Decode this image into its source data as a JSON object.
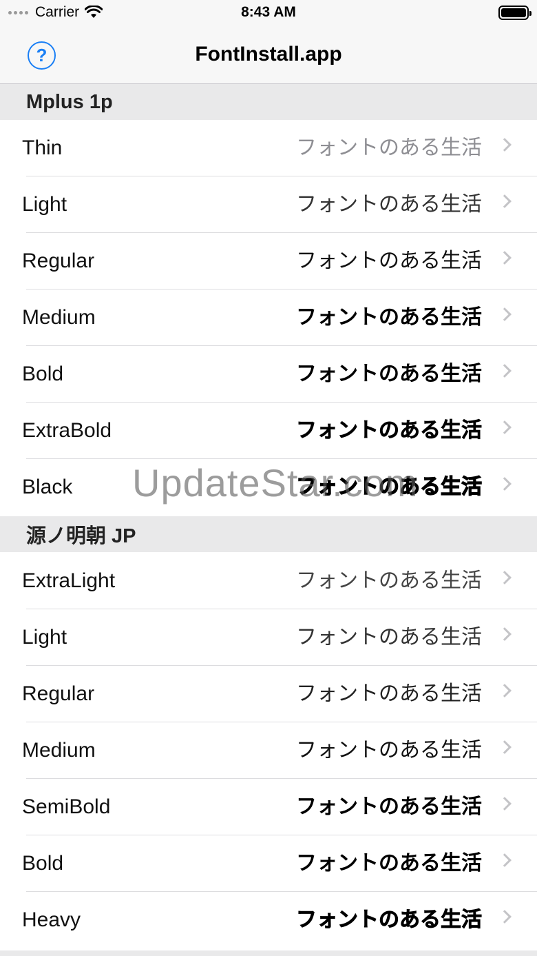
{
  "status": {
    "carrier": "Carrier",
    "time": "8:43 AM",
    "wifi_icon": "wifi-icon",
    "battery_icon": "battery-icon"
  },
  "nav": {
    "title": "FontInstall.app",
    "help_glyph": "?"
  },
  "watermark": "UpdateStar.com",
  "sample_text": "フォントのある生活",
  "sections": [
    {
      "title": "Mplus 1p",
      "rows": [
        {
          "label": "Thin",
          "sample": "フォントのある生活"
        },
        {
          "label": "Light",
          "sample": "フォントのある生活"
        },
        {
          "label": "Regular",
          "sample": "フォントのある生活"
        },
        {
          "label": "Medium",
          "sample": "フォントのある生活"
        },
        {
          "label": "Bold",
          "sample": "フォントのある生活"
        },
        {
          "label": "ExtraBold",
          "sample": "フォントのある生活"
        },
        {
          "label": "Black",
          "sample": "フォントのある生活"
        }
      ]
    },
    {
      "title": "源ノ明朝 JP",
      "rows": [
        {
          "label": "ExtraLight",
          "sample": "フォントのある生活"
        },
        {
          "label": "Light",
          "sample": "フォントのある生活"
        },
        {
          "label": "Regular",
          "sample": "フォントのある生活"
        },
        {
          "label": "Medium",
          "sample": "フォントのある生活"
        },
        {
          "label": "SemiBold",
          "sample": "フォントのある生活"
        },
        {
          "label": "Bold",
          "sample": "フォントのある生活"
        },
        {
          "label": "Heavy",
          "sample": "フォントのある生活"
        }
      ]
    }
  ],
  "colors": {
    "accent": "#1a7ff5",
    "section_bg": "#e9e9ea",
    "bar_bg": "#f7f7f7"
  }
}
